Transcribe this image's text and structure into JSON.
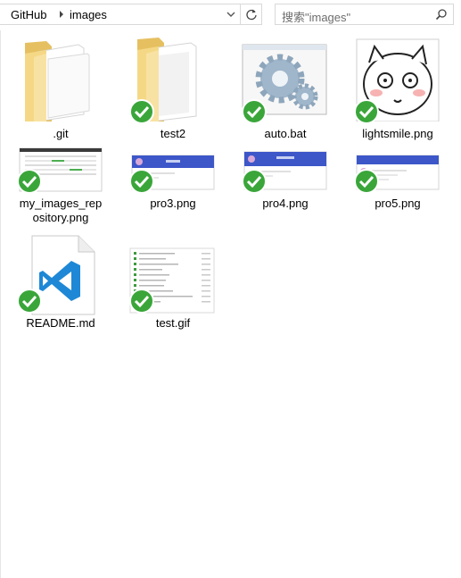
{
  "address_bar": {
    "crumbs": [
      "GitHub",
      "images"
    ]
  },
  "search": {
    "placeholder": "搜索\"images\""
  },
  "items": [
    {
      "name": ".git",
      "icon": "folder-icon",
      "synced": false
    },
    {
      "name": "test2",
      "icon": "folder-icon",
      "synced": true
    },
    {
      "name": "auto.bat",
      "icon": "batch-file-gears-icon",
      "synced": true
    },
    {
      "name": "lightsmile.png",
      "icon": "cartoon-face-thumbnail",
      "synced": true
    },
    {
      "name": "my_images_rep",
      "name_line2": "ository.png",
      "icon": "screenshot-thumbnail",
      "synced": true
    },
    {
      "name": "pro3.png",
      "icon": "screenshot-thumbnail",
      "synced": true
    },
    {
      "name": "pro4.png",
      "icon": "screenshot-thumbnail",
      "synced": true
    },
    {
      "name": "pro5.png",
      "icon": "screenshot-thumbnail",
      "synced": true
    },
    {
      "name": "README.md",
      "icon": "vscode-file-icon",
      "synced": true
    },
    {
      "name": "test.gif",
      "icon": "file-list-thumbnail",
      "synced": true
    }
  ],
  "colors": {
    "check_green": "#3aa63a",
    "folder_yellow": "#f3d57d",
    "vscode_blue": "#1e88d6",
    "thumb_header_blue": "#3d57c9"
  }
}
